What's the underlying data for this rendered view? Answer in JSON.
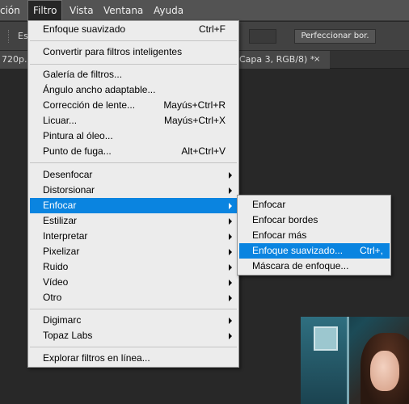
{
  "menubar": {
    "items": [
      {
        "label": "ción"
      },
      {
        "label": "Filtro",
        "active": true
      },
      {
        "label": "Vista"
      },
      {
        "label": "Ventana"
      },
      {
        "label": "Ayuda"
      }
    ]
  },
  "optionsbar": {
    "left_text": "Es",
    "refine_button": "Perfeccionar bor."
  },
  "tabs": {
    "left_tab": "720p.",
    "right_tab": "Capa 3, RGB/8) *",
    "close_glyph": "×"
  },
  "filter_menu": {
    "items": [
      {
        "label": "Enfoque suavizado",
        "shortcut": "Ctrl+F"
      },
      {
        "label": "Convertir para filtros inteligentes"
      },
      {
        "label": "Galería de filtros..."
      },
      {
        "label": "Ángulo ancho adaptable..."
      },
      {
        "label": "Corrección de lente...",
        "shortcut": "Mayús+Ctrl+R"
      },
      {
        "label": "Licuar...",
        "shortcut": "Mayús+Ctrl+X"
      },
      {
        "label": "Pintura al óleo..."
      },
      {
        "label": "Punto de fuga...",
        "shortcut": "Alt+Ctrl+V"
      },
      {
        "label": "Desenfocar",
        "submenu": true
      },
      {
        "label": "Distorsionar",
        "submenu": true
      },
      {
        "label": "Enfocar",
        "submenu": true,
        "highlighted": true
      },
      {
        "label": "Estilizar",
        "submenu": true
      },
      {
        "label": "Interpretar",
        "submenu": true
      },
      {
        "label": "Pixelizar",
        "submenu": true
      },
      {
        "label": "Ruido",
        "submenu": true
      },
      {
        "label": "Vídeo",
        "submenu": true
      },
      {
        "label": "Otro",
        "submenu": true
      },
      {
        "label": "Digimarc",
        "submenu": true
      },
      {
        "label": "Topaz Labs",
        "submenu": true
      },
      {
        "label": "Explorar filtros en línea..."
      }
    ]
  },
  "enfocar_submenu": {
    "items": [
      {
        "label": "Enfocar"
      },
      {
        "label": "Enfocar bordes"
      },
      {
        "label": "Enfocar más"
      },
      {
        "label": "Enfoque suavizado...",
        "shortcut": "Ctrl+,",
        "highlighted": true
      },
      {
        "label": "Máscara de enfoque..."
      }
    ]
  },
  "colors": {
    "menubar_bg": "#535353",
    "menu_bg": "#ececec",
    "highlight": "#0a84e0",
    "workspace_bg": "#282828"
  }
}
